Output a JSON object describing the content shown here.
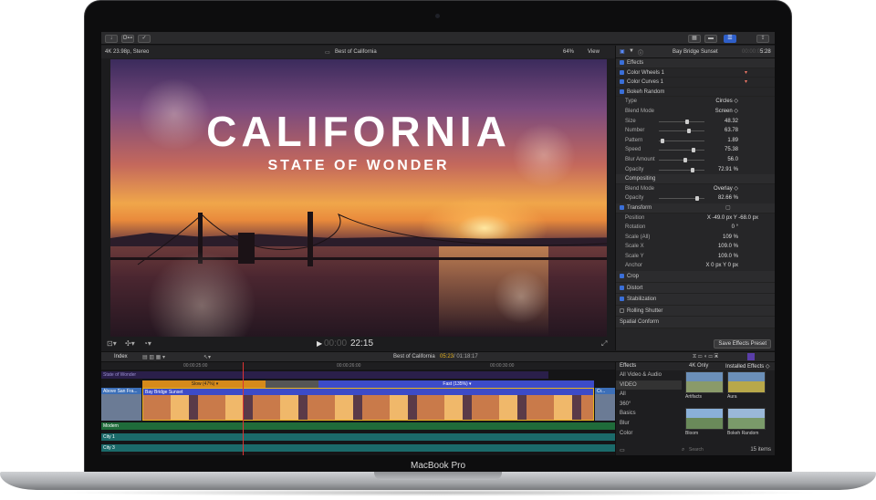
{
  "device": {
    "label": "MacBook Pro"
  },
  "toolbar": {
    "btn_import": "↓",
    "btn_keywords": "O⊷",
    "btn_check": "✓",
    "btn_share": "⇪"
  },
  "viewer_info": {
    "format": "4K 23.98p, Stereo",
    "title": "Best of California",
    "zoom": "64%",
    "view_menu": "View"
  },
  "video": {
    "title": "CALIFORNIA",
    "subtitle": "STATE OF WONDER"
  },
  "controls": {
    "timecode_dim": "00:00",
    "timecode": "22:15"
  },
  "inspector": {
    "clip_name": "Bay Bridge Sunset",
    "duration_dim": "00:00:0",
    "duration": "5:28",
    "effects_label": "Effects",
    "effect_items": [
      "Color Wheels 1",
      "Color Curves 1",
      "Bokeh Random"
    ],
    "bokeh_params": [
      {
        "label": "Type",
        "value": "Circles ◇"
      },
      {
        "label": "Blend Mode",
        "value": "Screen ◇"
      },
      {
        "label": "Size",
        "value": "48.32",
        "level": 0.6
      },
      {
        "label": "Number",
        "value": "63.78",
        "level": 0.65
      },
      {
        "label": "Pattern",
        "value": "1.89",
        "level": 0.05
      },
      {
        "label": "Speed",
        "value": "75.38",
        "level": 0.75
      },
      {
        "label": "Blur Amount",
        "value": "56.0",
        "level": 0.56
      },
      {
        "label": "Opacity",
        "value": "72.91 %",
        "level": 0.73
      }
    ],
    "compositing_label": "Compositing",
    "comp_params": [
      {
        "label": "Blend Mode",
        "value": "Overlay ◇"
      },
      {
        "label": "Opacity",
        "value": "82.66 %",
        "level": 0.83
      }
    ],
    "transform_label": "Transform",
    "transform_params": [
      {
        "label": "Position",
        "value": "X   -49.0 px   Y   -68.0 px"
      },
      {
        "label": "Rotation",
        "value": "0 °"
      },
      {
        "label": "Scale (All)",
        "value": "109 %"
      },
      {
        "label": "Scale X",
        "value": "109.0 %"
      },
      {
        "label": "Scale Y",
        "value": "109.0 %"
      },
      {
        "label": "Anchor",
        "value": "X   0 px   Y   0 px"
      }
    ],
    "sections": [
      "Crop",
      "Distort",
      "Stabilization",
      "Rolling Shutter",
      "Spatial Conform"
    ],
    "save_button": "Save Effects Preset"
  },
  "timeline_bar": {
    "index": "Index",
    "project": "Best of California",
    "time_current": "05:23",
    "time_total": " / 01:18:17"
  },
  "timeline": {
    "ruler": [
      "00:00:25:00",
      "00:00:26:00",
      "00:00:30:00"
    ],
    "title_clip": "State of Wonder",
    "speed_slow": "Slow (47%) ▾",
    "speed_fast": "Fast (135%) ▾",
    "clip_left": "Above San Fra...",
    "clip_main": "Bay Bridge Sunset",
    "clip_right": "Cr...",
    "audio_1": "Modern",
    "audio_2": "City 1",
    "audio_3": "City 3"
  },
  "effects_browser": {
    "header": "Effects",
    "filter": "4K Only",
    "installed": "Installed Effects ◇",
    "categories": [
      "All Video & Audio",
      "VIDEO",
      "All",
      "360°",
      "Basics",
      "Blur",
      "Color"
    ],
    "items": [
      "Artifacts",
      "Aura",
      "Bloom",
      "Bokeh Random"
    ],
    "search_placeholder": "Search",
    "count": "15 items"
  }
}
